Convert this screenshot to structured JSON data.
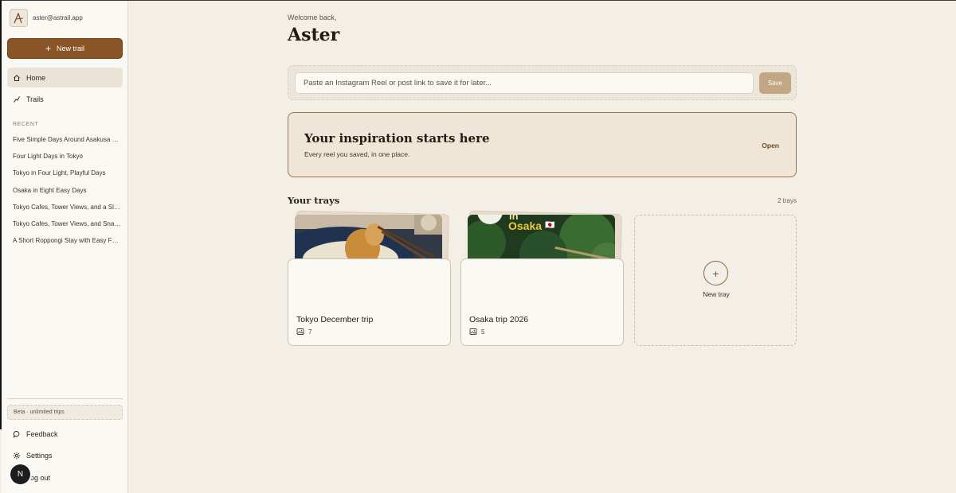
{
  "account": {
    "email": "aster@astrail.app",
    "logo_letter": "A"
  },
  "sidebar": {
    "new_trail_label": "New trail",
    "nav": [
      {
        "label": "Home",
        "icon": "home-icon",
        "active": true
      },
      {
        "label": "Trails",
        "icon": "trail-icon",
        "active": false
      }
    ],
    "recent_label": "RECENT",
    "recent": [
      "Five Simple Days Around Asakusa and Ueno",
      "Four Light Days in Tokyo",
      "Tokyo in Four Light, Playful Days",
      "Osaka in Eight Easy Days",
      "Tokyo Cafes, Tower Views, and a Slow Stroll",
      "Tokyo Cafes, Tower Views, and Snacks",
      "A Short Roppongi Stay with Easy Food"
    ],
    "beta_label": "Beta · unlimited trips",
    "bottom": [
      {
        "label": "Feedback",
        "icon": "chat-bubble-icon"
      },
      {
        "label": "Settings",
        "icon": "gear-icon"
      },
      {
        "label": "Log out",
        "icon": "logout-icon"
      }
    ],
    "avatar_letter": "N"
  },
  "main": {
    "welcome": "Welcome back,",
    "username": "Aster",
    "paste_placeholder": "Paste an Instagram Reel or post link to save it for later...",
    "save_label": "Save",
    "inspiration": {
      "title": "Your inspiration starts here",
      "subtitle": "Every reel you saved, in one place.",
      "open_label": "Open"
    },
    "trays_title": "Your trays",
    "trays_count": "2 trays",
    "trays": [
      {
        "name": "Tokyo December trip",
        "count": "7",
        "thumb": "food-photo"
      },
      {
        "name": "Osaka trip 2026",
        "count": "5",
        "thumb": "osaka-garden-photo",
        "overlay_text": "in",
        "overlay_title": "Osaka",
        "overlay_emoji": "🇯🇵"
      }
    ],
    "new_tray_label": "New tray",
    "new_tray_plus": "+"
  },
  "colors": {
    "accent": "#8a5526",
    "background": "#f3efe6",
    "sidebar": "#faf8f3"
  }
}
